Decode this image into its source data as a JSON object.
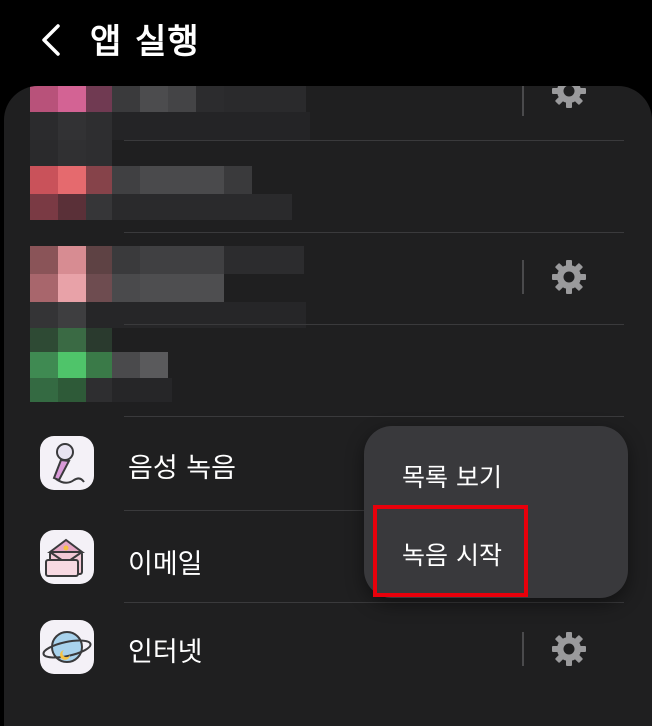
{
  "header": {
    "title": "앱 실행",
    "back_icon": "chevron-left-icon"
  },
  "apps": [
    {
      "label": "음성 녹음",
      "icon": "microphone-icon"
    },
    {
      "label": "이메일",
      "icon": "envelope-icon"
    },
    {
      "label": "인터넷",
      "icon": "planet-icon"
    }
  ],
  "popup": {
    "items": [
      "목록 보기",
      "녹음 시작"
    ]
  },
  "colors": {
    "background": "#000000",
    "panel": "#1f1f20",
    "popup": "#39393c",
    "highlight": "#e8000b"
  }
}
